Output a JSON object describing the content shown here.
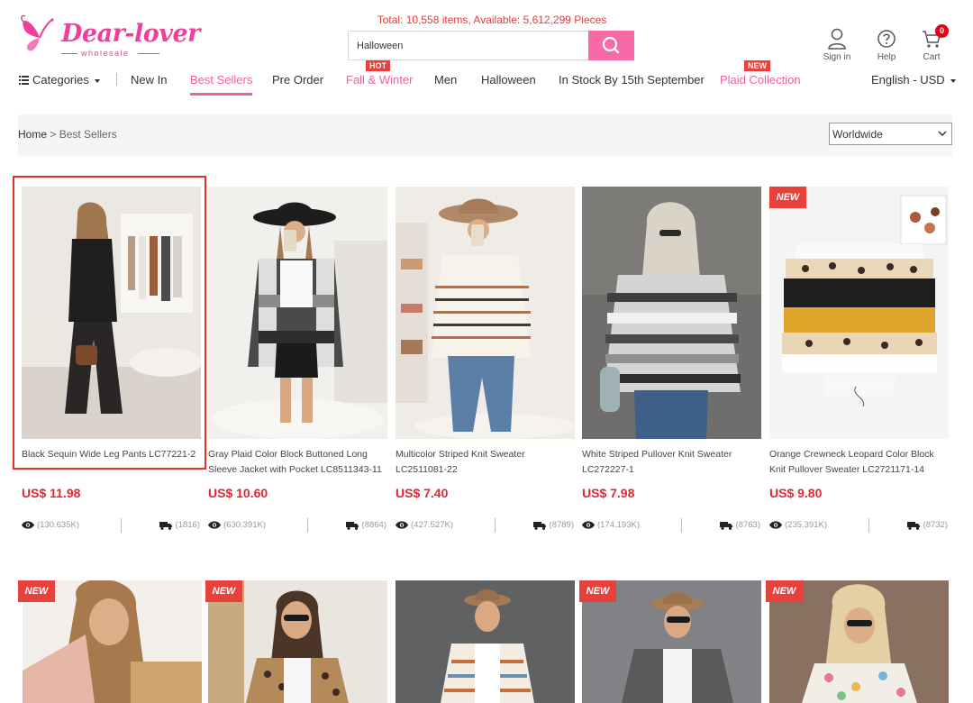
{
  "header": {
    "logo_text": "Dear-lover",
    "logo_sub": "wholesale",
    "stats": "Total: 10,558 items, Available: 5,612,299 Pieces",
    "search_value": "Halloween",
    "sign_in": "Sign in",
    "help": "Help",
    "cart": "Cart",
    "cart_count": "0"
  },
  "nav": {
    "categories": "Categories",
    "new_in": "New In",
    "best_sellers": "Best Sellers",
    "pre_order": "Pre Order",
    "fall_winter": "Fall & Winter",
    "hot_tag": "HOT",
    "men": "Men",
    "halloween": "Halloween",
    "in_stock": "In Stock By 15th September",
    "plaid": "Plaid Collection",
    "new_tag": "NEW",
    "lang": "English - USD"
  },
  "breadcrumb": {
    "home": "Home",
    "sep": " > ",
    "current": "Best Sellers",
    "region": "Worldwide"
  },
  "colors": {
    "brand_pink": "#ee3f9b",
    "price_red": "#e4262c",
    "badge_red": "#e8413c"
  },
  "new_badge": "NEW",
  "products": [
    {
      "title": "Black Sequin Wide Leg Pants LC77221-2",
      "price": "US$ 11.98",
      "views": "(130.635K)",
      "ships": "(1816)"
    },
    {
      "title": "Gray Plaid Color Block Buttoned Long Sleeve Jacket with Pocket LC8511343-11",
      "price": "US$ 10.60",
      "views": "(630.391K)",
      "ships": "(8864)"
    },
    {
      "title": "Multicolor Striped Knit Sweater LC2511081-22",
      "price": "US$ 7.40",
      "views": "(427.527K)",
      "ships": "(8789)"
    },
    {
      "title": "White Striped Pullover Knit Sweater LC272227-1",
      "price": "US$ 7.98",
      "views": "(174.193K)",
      "ships": "(8763)"
    },
    {
      "title": "Orange Crewneck Leopard Color Block Knit Pullover Sweater LC2721171-14",
      "price": "US$ 9.80",
      "views": "(235.391K)",
      "ships": "(8732)"
    }
  ]
}
